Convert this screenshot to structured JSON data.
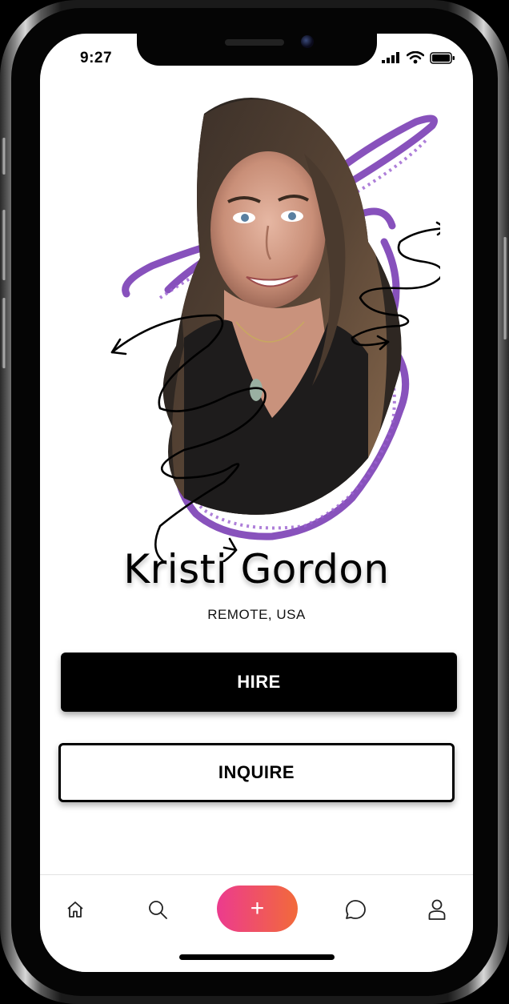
{
  "status_bar": {
    "time": "9:27"
  },
  "profile": {
    "name": "Kristi Gordon",
    "location": "REMOTE, USA"
  },
  "actions": {
    "hire_label": "HIRE",
    "inquire_label": "INQUIRE"
  },
  "tab_bar": {
    "items": [
      {
        "icon": "home-icon"
      },
      {
        "icon": "search-icon"
      },
      {
        "icon": "plus-icon",
        "label": "+"
      },
      {
        "icon": "chat-icon"
      },
      {
        "icon": "profile-icon"
      }
    ]
  },
  "colors": {
    "accent_gradient_start": "#ec3b8e",
    "accent_gradient_end": "#f26a3a",
    "scribble_purple": "#7b3fb5",
    "primary_button": "#000000"
  }
}
